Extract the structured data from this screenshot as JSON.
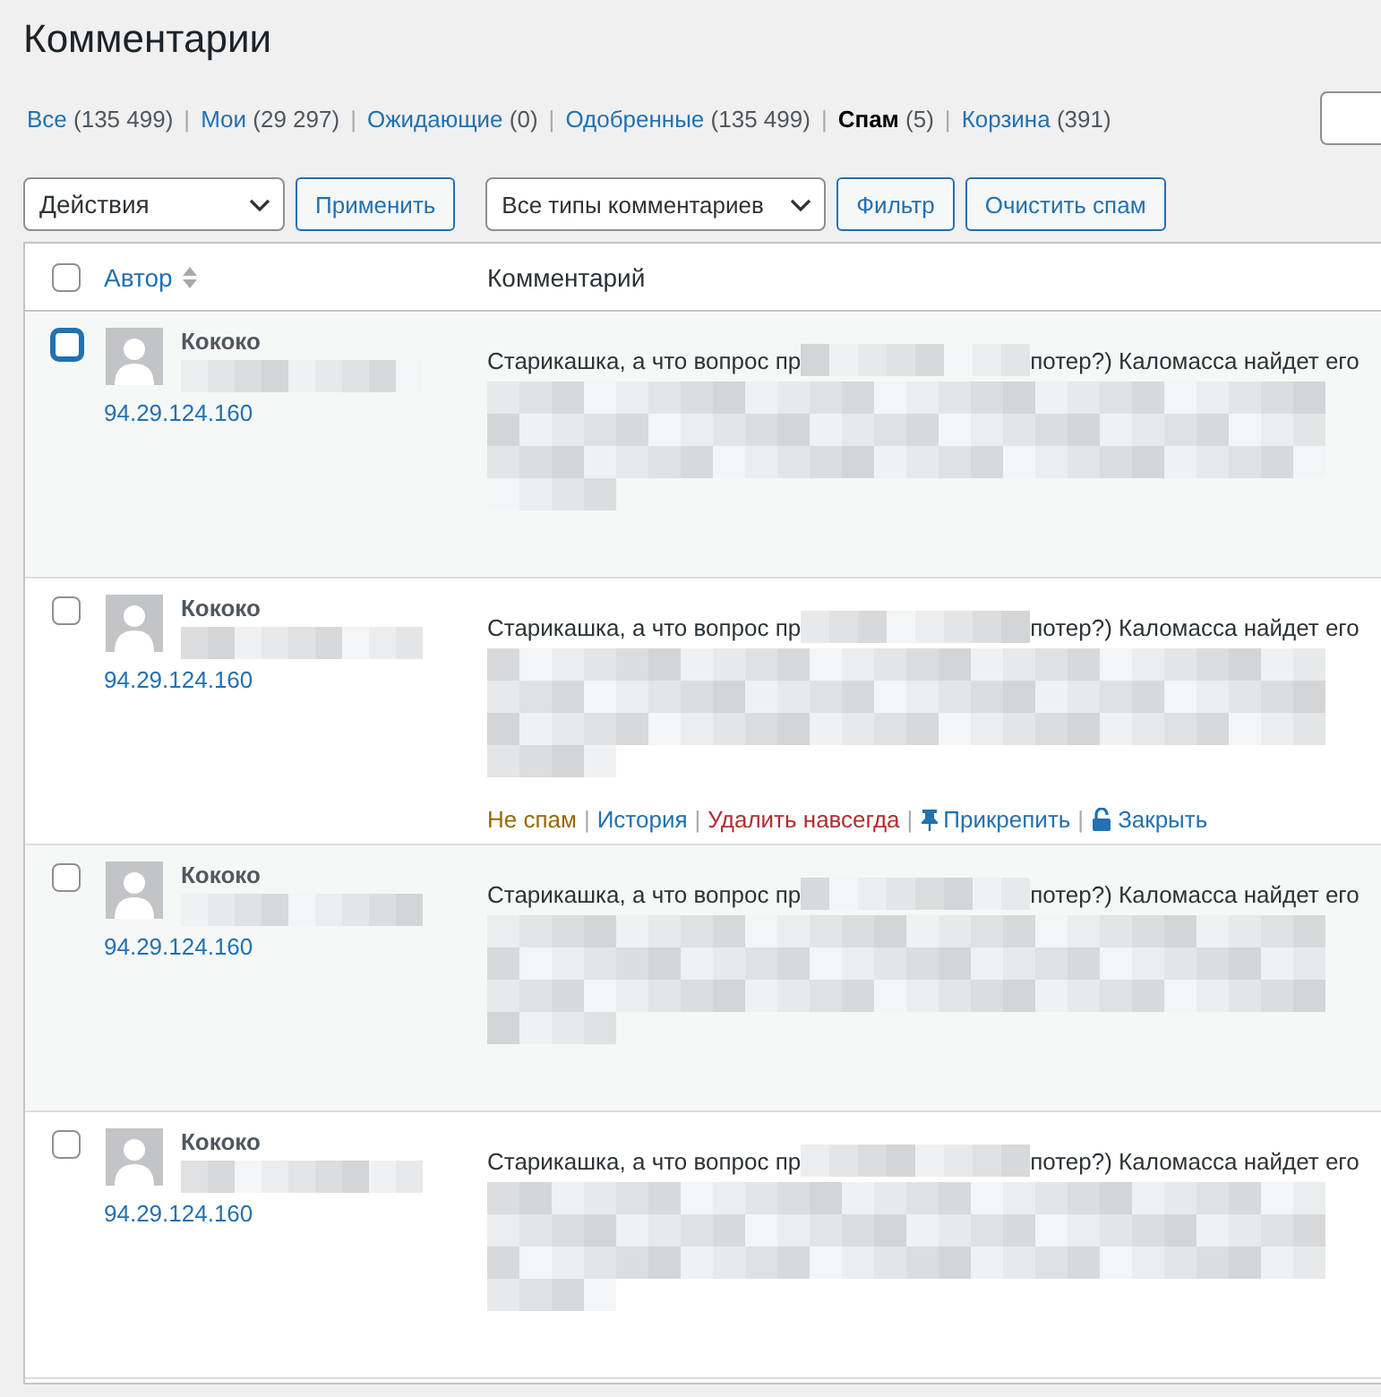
{
  "page_title": "Комментарии",
  "filters": [
    {
      "label": "Все",
      "count": "(135 499)",
      "selected": false
    },
    {
      "separator_before": "|",
      "label": "Мои",
      "count": "(29 297)",
      "selected": false
    },
    {
      "separator_before": "|",
      "label": "Ожидающие",
      "count": "(0)",
      "selected": false
    },
    {
      "separator_before": "|",
      "label": "Одобренные",
      "count": "(135 499)",
      "selected": false
    },
    {
      "separator_before": "|",
      "label": "Спам",
      "count": "(5)",
      "selected": true
    },
    {
      "separator_before": "|",
      "label": "Корзина",
      "count": "(391)",
      "selected": false
    }
  ],
  "bulk_actions": {
    "value": "Действия"
  },
  "apply_button": "Применить",
  "comment_type": {
    "value": "Все типы комментариев"
  },
  "filter_button": "Фильтр",
  "empty_spam_button": "Очистить спам",
  "table": {
    "select_all": {
      "checked": false
    },
    "columns": [
      "Автор",
      "Комментарий"
    ],
    "rows": [
      {
        "author": "Кококо",
        "ip": "94.29.124.160",
        "checked": false,
        "focused": true,
        "text_start": "Старикашка, а что вопрос пр",
        "text_end": "потер?) Каломасса найдет его"
      },
      {
        "author": "Кококо",
        "ip": "94.29.124.160",
        "checked": false,
        "focused": false,
        "text_start": "Старикашка, а что вопрос пр",
        "text_end": "потер?) Каломасса найдет его",
        "actions": [
          {
            "kind": "unspam",
            "label": "Не спам"
          },
          {
            "separator_before": "|",
            "kind": "history",
            "label": "История"
          },
          {
            "separator_before": "|",
            "kind": "delete",
            "label": "Удалить навсегда"
          },
          {
            "separator_before": "|",
            "kind": "pin",
            "label": "Прикрепить"
          },
          {
            "separator_before": "|",
            "kind": "close",
            "label": "Закрыть"
          }
        ]
      },
      {
        "author": "Кококо",
        "ip": "94.29.124.160",
        "checked": false,
        "focused": false,
        "text_start": "Старикашка, а что вопрос пр",
        "text_end": "потер?) Каломасса найдет его"
      },
      {
        "author": "Кококо",
        "ip": "94.29.124.160",
        "checked": false,
        "focused": false,
        "text_start": "Старикашка, а что вопрос пр",
        "text_end": "потер?) Каломасса найдет его"
      }
    ]
  }
}
